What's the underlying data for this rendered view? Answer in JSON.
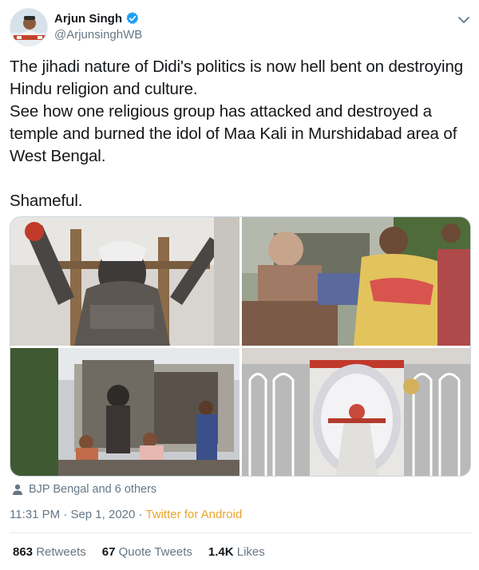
{
  "author": {
    "display_name": "Arjun Singh",
    "handle": "@ArjunsinghWB",
    "verified": true
  },
  "tweet": {
    "paragraphs": [
      "The jihadi nature of Didi's politics is now hell bent on destroying Hindu religion and culture.",
      "See how one religious group has attacked and destroyed a temple and burned the idol of Maa Kali in Murshidabad area of West Bengal.",
      "",
      "Shameful."
    ]
  },
  "social_context": {
    "icon": "person-icon",
    "text": "BJP Bengal and 6 others"
  },
  "meta": {
    "time": "11:31 PM",
    "separator": " · ",
    "date": "Sep 1, 2020",
    "source": "Twitter for Android"
  },
  "stats": {
    "retweets_count": "863",
    "retweets_label": "Retweets",
    "quotes_count": "67",
    "quotes_label": "Quote Tweets",
    "likes_count": "1.4K",
    "likes_label": "Likes"
  },
  "colors": {
    "text": "#14171a",
    "secondary": "#657786",
    "verified": "#1da1f2",
    "source_link": "#e8a52e",
    "border": "#e6ecf0"
  }
}
